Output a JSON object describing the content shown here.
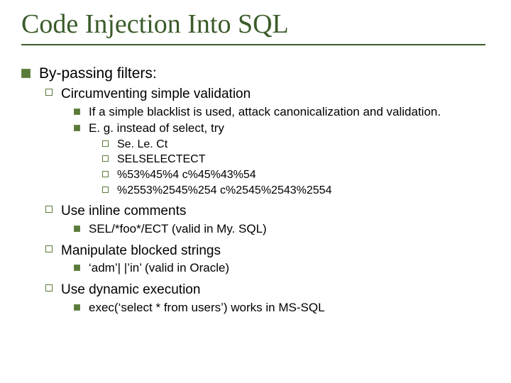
{
  "title": "Code Injection Into SQL",
  "b1_1": "By-passing filters:",
  "b2_1": "Circumventing simple validation",
  "b3_1": "If a simple blacklist is used, attack canonicalization and validation.",
  "b3_2": "E. g. instead of select, try",
  "b4_1": "Se. Le. Ct",
  "b4_2": "SELSELECTECT",
  "b4_3": "%53%45%4 c%45%43%54",
  "b4_4": "%2553%2545%254 c%2545%2543%2554",
  "b2_2": "Use inline comments",
  "b3_3": "SEL/*foo*/ECT (valid in My. SQL)",
  "b2_3": "Manipulate blocked strings",
  "b3_4": "‘adm’| |’in’ (valid in Oracle)",
  "b2_4": "Use dynamic execution",
  "b3_5": "exec(‘select * from users’) works in MS-SQL"
}
